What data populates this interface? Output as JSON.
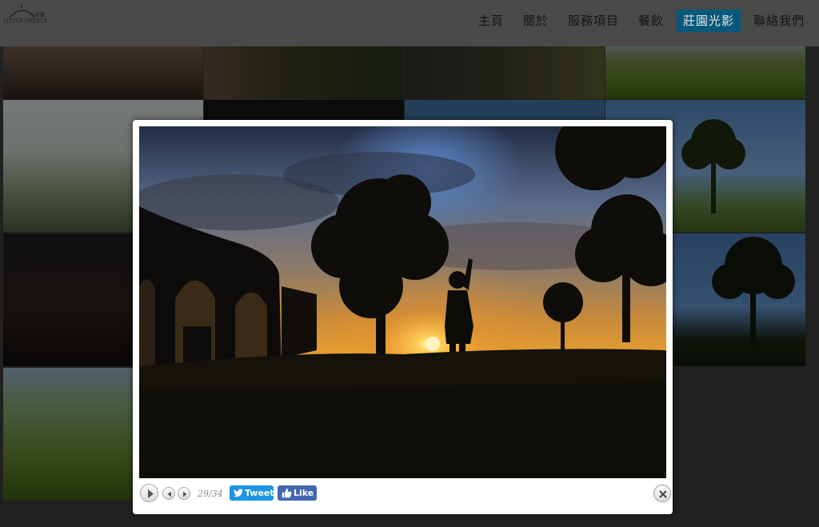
{
  "header": {
    "logo_text": "LITTLE GREECE",
    "logo_small_text": "小希臘",
    "nav": [
      {
        "label": "主頁"
      },
      {
        "label": "關於"
      },
      {
        "label": "服務項目"
      },
      {
        "label": "餐飲"
      },
      {
        "label": "莊園光影",
        "active": true
      },
      {
        "label": "聯絡我們"
      }
    ]
  },
  "lightbox": {
    "counter": "29/34",
    "tweet_label": "Tweet",
    "like_label": "Like 0",
    "play_icon": "play-icon",
    "prev_icon": "prev-icon",
    "next_icon": "next-icon",
    "close_icon": "close-icon"
  },
  "colors": {
    "active_nav_bg": "#07597b",
    "tweet_blue": "#1b95e0",
    "facebook_blue": "#4267b2"
  }
}
